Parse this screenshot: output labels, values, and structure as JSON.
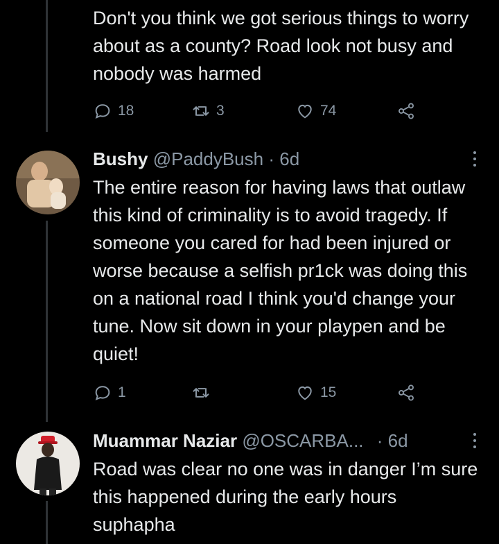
{
  "tweets": [
    {
      "text": "Don't you think we got serious things to worry about as a county? Road look not busy and nobody was harmed",
      "replies": "18",
      "retweets": "3",
      "likes": "74"
    },
    {
      "name": "Bushy",
      "handle": "@PaddyBush",
      "separator": "·",
      "time": "6d",
      "text": "The entire reason for having laws that outlaw this kind of criminality is to avoid tragedy. If someone you cared for had been injured or worse because a selfish pr1ck was doing this on a national road I think you'd change your tune. Now sit down in your playpen and be quiet!",
      "replies": "1",
      "retweets": "",
      "likes": "15"
    },
    {
      "name": "Muammar Naziar",
      "handle": "@OSCARBA...",
      "separator": "·",
      "time": "6d",
      "text": "Road was clear no one was in danger I’m sure this happened during the early hours suphapha"
    }
  ],
  "colors": {
    "background": "#000000",
    "text": "#e7e9ea",
    "secondary": "#8b98a5",
    "thread_line": "#2f3336"
  },
  "icons": [
    "reply-icon",
    "retweet-icon",
    "like-icon",
    "share-icon",
    "more-icon"
  ]
}
